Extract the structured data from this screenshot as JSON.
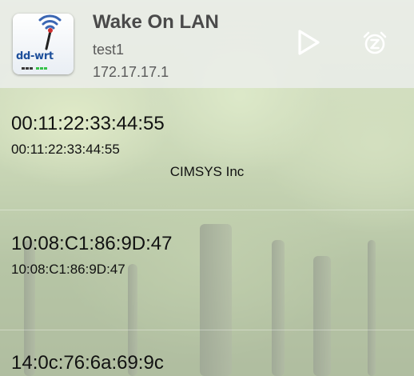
{
  "header": {
    "app_icon_name": "dd-wrt-logo-icon",
    "app_icon_text": "dd-wrt",
    "title": "Wake On LAN",
    "subtitle": "test1",
    "ip": "172.17.17.1",
    "play_icon": "play-icon",
    "alarm_icon": "alarm-snooze-icon"
  },
  "devices": [
    {
      "name": "00:11:22:33:44:55",
      "mac": "00:11:22:33:44:55",
      "vendor": "CIMSYS Inc"
    },
    {
      "name": "10:08:C1:86:9D:47",
      "mac": "10:08:C1:86:9D:47",
      "vendor": ""
    },
    {
      "name": "14:0c:76:6a:69:9c",
      "mac": "",
      "vendor": ""
    }
  ],
  "colors": {
    "header_bg": "#ecEEEC",
    "title_text": "#4a4a4a",
    "icon_gray": "#ffffff",
    "brand_blue": "#1e4f9b"
  }
}
